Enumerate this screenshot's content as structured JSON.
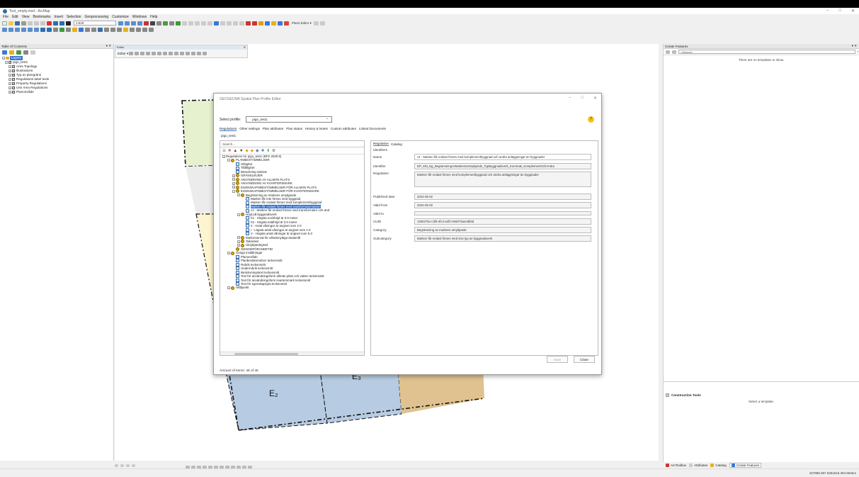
{
  "app": {
    "title": "Test_empty.mxd - ArcMap",
    "menu": [
      "File",
      "Edit",
      "View",
      "Bookmarks",
      "Insert",
      "Selection",
      "Geoprocessing",
      "Customize",
      "Windows",
      "Help"
    ],
    "scale": "1:619",
    "plans_editor": "Plans Editor ▾"
  },
  "toc": {
    "title": "Table Of Contents",
    "layers_label": "Layers",
    "group": "pigo_test1",
    "items": [
      "Area Topology",
      "Illustrations",
      "Typ av plangräns",
      "Regulations label texts",
      "Property Regulations",
      "Use Area Regulations",
      "Planområde"
    ]
  },
  "editor_toolbar": {
    "title": "Editor",
    "label": "Editor ▾"
  },
  "map": {
    "labels": [
      "E₂",
      "E₃"
    ]
  },
  "dialog": {
    "title": "GEOSECMA Spatial Plan Profile Editor",
    "select_profile_label": "Select profile:",
    "profile": "pigo_test1",
    "help": "?",
    "tabs": [
      "Regulations",
      "Other settings",
      "Plan attributes",
      "Plan status",
      "History & Notes",
      "Custom attributes",
      "Linked Documents"
    ],
    "subtitle": "pigo_test1",
    "search_placeholder": "Search...",
    "tree": [
      {
        "label": "Regulations for pigo_test1 (BFS 2020:5)",
        "level": 0,
        "ex": "−",
        "icon": "none"
      },
      {
        "label": "PLANBESTÄMMELSER",
        "level": 1,
        "ex": "−",
        "icon": "group"
      },
      {
        "label": "Giltighet",
        "level": 2,
        "ex": "",
        "icon": "leaf"
      },
      {
        "label": "Tillåtlighet",
        "level": 2,
        "ex": "",
        "icon": "leaf"
      },
      {
        "label": "Beteckning saknas",
        "level": 2,
        "ex": "",
        "icon": "leaf"
      },
      {
        "label": "GRÄNSLINJER",
        "level": 2,
        "ex": "+",
        "icon": "group"
      },
      {
        "label": "ANVÄNDNING AV ALLMÄN PLATS",
        "level": 2,
        "ex": "+",
        "icon": "group"
      },
      {
        "label": "ANVÄNDNING AV KVARTERSMARK",
        "level": 2,
        "ex": "+",
        "icon": "group"
      },
      {
        "label": "EGENSKAPSBESTÄMMELSER FÖR ALLMÄN PLATS",
        "level": 2,
        "ex": "+",
        "icon": "group"
      },
      {
        "label": "EGENSKAPSBESTÄMMELSER FÖR KVARTERSMARK",
        "level": 2,
        "ex": "−",
        "icon": "group"
      },
      {
        "label": "Begränsning av markens utnyttjande",
        "level": 3,
        "ex": "−",
        "icon": "group"
      },
      {
        "label": "Marken får inte förses med byggnad",
        "level": 4,
        "ex": "",
        "icon": "leaf"
      },
      {
        "label": "Marken får endast förses med komplementbyggnad",
        "level": 4,
        "ex": "",
        "icon": "leaf"
      },
      {
        "label": "Marken får endast förses med transformatorstation",
        "level": 4,
        "ex": "",
        "icon": "leaf",
        "selected": true
      },
      {
        "label": "c2 - Marken får endast förses med transformator och and",
        "level": 4,
        "ex": "",
        "icon": "leaf"
      },
      {
        "label": "Höjd på byggnadsverk",
        "level": 3,
        "ex": "−",
        "icon": "group"
      },
      {
        "label": "h1 - Högsta nockhöjd är 0.0 meter",
        "level": 4,
        "ex": "",
        "icon": "leaf"
      },
      {
        "label": "h2 - Högsta totalhöjd är 0.0 meter",
        "level": 4,
        "ex": "",
        "icon": "leaf"
      },
      {
        "label": "II - Antal våningar är angivet som 2.0",
        "level": 4,
        "ex": "",
        "icon": "leaf"
      },
      {
        "label": "I - Lägsta antal våningar är angivet som 1.0",
        "level": 4,
        "ex": "",
        "icon": "leaf"
      },
      {
        "label": "V - Högsta antal våningar är angivet som 5.0",
        "level": 4,
        "ex": "",
        "icon": "leaf"
      },
      {
        "label": "Markreservat för allmännyttiga ändamål",
        "level": 3,
        "ex": "+",
        "icon": "group"
      },
      {
        "label": "Takvinkel",
        "level": 3,
        "ex": "+",
        "icon": "group"
      },
      {
        "label": "Utnyttjandegrad",
        "level": 3,
        "ex": "+",
        "icon": "group"
      },
      {
        "label": "GENOMFÖRANDETID",
        "level": 2,
        "ex": "",
        "icon": "group"
      },
      {
        "label": "Övriga inställningar",
        "level": 1,
        "ex": "−",
        "icon": "group"
      },
      {
        "label": "Planområde",
        "level": 2,
        "ex": "",
        "icon": "leaf"
      },
      {
        "label": "Planbestämmelser teckensnitt",
        "level": 2,
        "ex": "",
        "icon": "leaf"
      },
      {
        "label": "Rubrik teckensnitt",
        "level": 2,
        "ex": "",
        "icon": "leaf"
      },
      {
        "label": "Underrubrik teckensnitt",
        "level": 2,
        "ex": "",
        "icon": "leaf"
      },
      {
        "label": "Beskrivningstext teckensnitt",
        "level": 2,
        "ex": "",
        "icon": "leaf"
      },
      {
        "label": "Text för användningsform allmän plats och vatten teckensnitt",
        "level": 2,
        "ex": "",
        "icon": "leaf"
      },
      {
        "label": "Text för användningsform kvartersmark teckensnitt",
        "level": 2,
        "ex": "",
        "icon": "leaf"
      },
      {
        "label": "Text för egenskapsyta teckensnitt",
        "level": 2,
        "ex": "",
        "icon": "leaf"
      },
      {
        "label": "Hållpunkt",
        "level": 1,
        "ex": "+",
        "icon": "group"
      }
    ],
    "right_tabs": [
      "Regulation",
      "Catalog"
    ],
    "fields": {
      "identifiers_label": "Identifiers",
      "name_label": "Name",
      "name": "c4 - Marken får endast förses med komplementbyggnad och andra anläggningar än byggnader",
      "identifier_label": "Identifier",
      "identifier": "DP_KM_Eg_BegransningAvMarkensUtnyttjande_TypByggnadsverk_Kommak_KomplementOchAndra",
      "regulation_label": "Regulation",
      "regulation": "Marken får endast förses med komplementbyggnad och andra anläggningar än byggnader",
      "published_label": "Published date",
      "published": "2024-05-02",
      "valid_from_label": "Valid from",
      "valid_from": "2024-05-02",
      "valid_to_label": "Valid to",
      "valid_to": "",
      "uuid_label": "UUID",
      "uuid": "1250475c-c3f3-4fc4-a4f2-0e5073aeedb0d",
      "category_label": "Category",
      "category": "Begränsning av markens utnyttjande",
      "subcategory_label": "Subcategory",
      "subcategory": "Marken får endast förses med viss typ av byggnadsverk"
    },
    "save": "Save",
    "close": "Close",
    "amount": "Amount of items: 46 of 46"
  },
  "create_features": {
    "title": "Create Features",
    "search_placeholder": "<Search>",
    "empty_msg": "There are no templates to show.",
    "construction_title": "Construction Tools",
    "construction_msg": "Select a template."
  },
  "bottom_tabs": [
    "ArcToolbox",
    "Attributes",
    "Catalog",
    "Create Features"
  ],
  "status": {
    "coords": "157968.367 6251616.304 Meters"
  },
  "colors": {
    "selection": "#1f6bd2",
    "layer_select": "#3376d8",
    "map_green": "#e6f2cf",
    "map_yellow": "#fdf5cf",
    "map_blue": "#b7cbe2",
    "map_tan": "#dfc28f"
  }
}
